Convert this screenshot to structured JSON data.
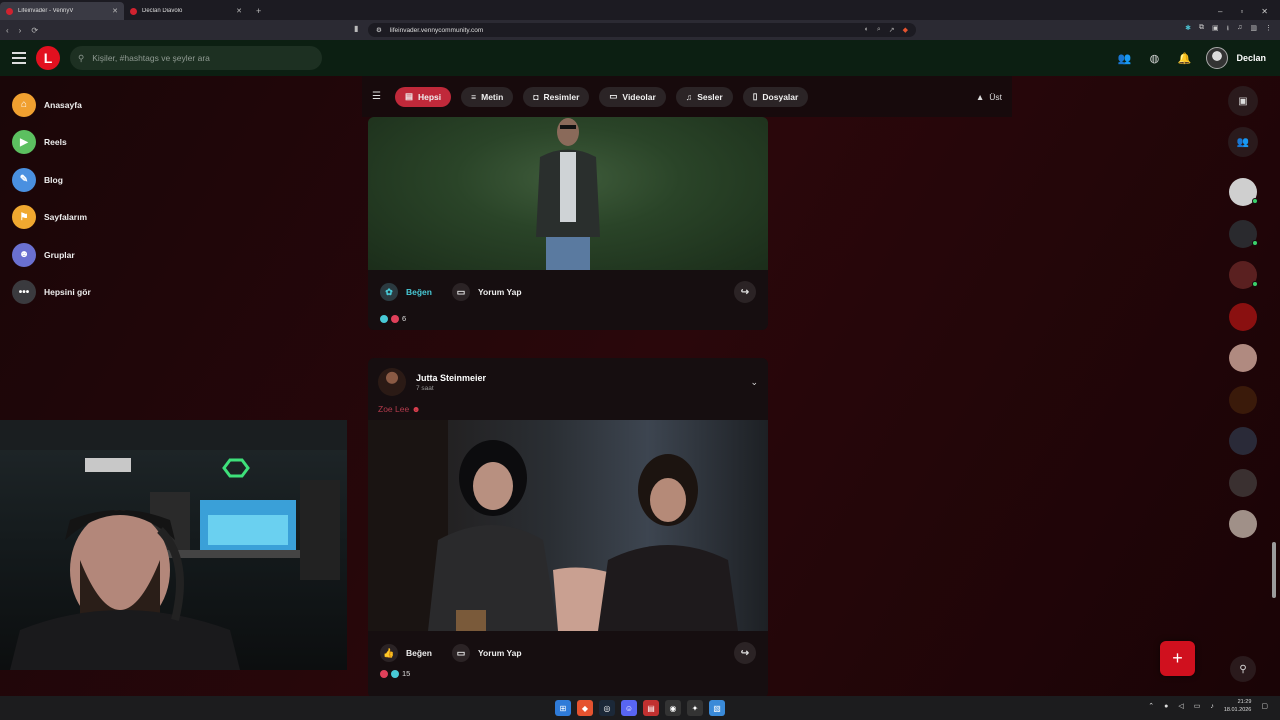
{
  "browser": {
    "tabs": [
      {
        "title": "Lifeinvader - VennyV",
        "active": true
      },
      {
        "title": "Declan Diavolo",
        "active": false
      }
    ],
    "url": "lifeinvader.vennycommunity.com"
  },
  "header": {
    "logo_letter": "L",
    "search_placeholder": "Kişiler, #hashtags ve şeyler ara",
    "username": "Declan"
  },
  "sidebar": {
    "items": [
      {
        "label": "Anasayfa",
        "icon": "home-icon",
        "color": "#f0a030"
      },
      {
        "label": "Reels",
        "icon": "reels-icon",
        "color": "#5cc060"
      },
      {
        "label": "Blog",
        "icon": "blog-icon",
        "color": "#4a90e0"
      },
      {
        "label": "Sayfalarım",
        "icon": "flag-icon",
        "color": "#f0a830"
      },
      {
        "label": "Gruplar",
        "icon": "group-icon",
        "color": "#6a70d0"
      },
      {
        "label": "Hepsini gör",
        "icon": "more-icon",
        "color": "#3a3a3e"
      }
    ]
  },
  "filters": {
    "items": [
      {
        "label": "Hepsi",
        "icon": "document-icon",
        "active": true
      },
      {
        "label": "Metin",
        "icon": "text-icon",
        "active": false
      },
      {
        "label": "Resimler",
        "icon": "camera-icon",
        "active": false
      },
      {
        "label": "Videolar",
        "icon": "video-icon",
        "active": false
      },
      {
        "label": "Sesler",
        "icon": "music-icon",
        "active": false
      },
      {
        "label": "Dosyalar",
        "icon": "file-icon",
        "active": false
      }
    ],
    "top_label": "Üst"
  },
  "posts": [
    {
      "like_label": "Beğen",
      "comment_label": "Yorum Yap",
      "reaction_count": "6"
    },
    {
      "author": "Jutta Steinmeier",
      "time": "7 saat",
      "text": "Zoe Lee",
      "like_label": "Beğen",
      "comment_label": "Yorum Yap",
      "reaction_count": "15"
    }
  ],
  "taskbar": {
    "time": "21:29",
    "date": "18.01.2026"
  },
  "colors": {
    "accent": "#c0293a",
    "fab": "#d0101e",
    "header_bg": "#0c1f12"
  }
}
